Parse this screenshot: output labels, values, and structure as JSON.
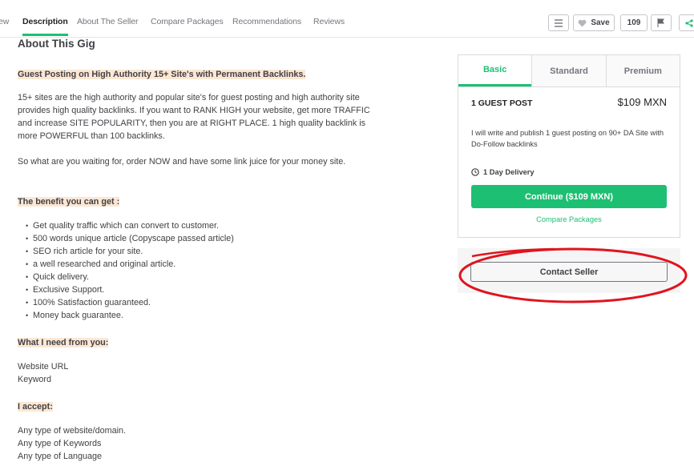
{
  "nav": {
    "tabs": [
      "ew",
      "Description",
      "About The Seller",
      "Compare Packages",
      "Recommendations",
      "Reviews"
    ],
    "save_label": "Save",
    "save_count": "109"
  },
  "main": {
    "title": "About This Gig",
    "headline": "Guest Posting on High Authority 15+ Site's with Permanent Backlinks.",
    "intro_lines": [
      "15+ sites are the high authority and popular site's for guest posting and high authority site",
      "provides high quality backlinks. If you want to RANK HIGH your website, get more TRAFFIC",
      "and increase SITE POPULARITY, then you are at RIGHT PLACE. 1 high quality backlink is",
      "more POWERFUL than 100 backlinks."
    ],
    "cta_line": "So what are you waiting for, order NOW and have some link juice for your money site.",
    "benefit_heading": "The benefit you can get :",
    "benefits": [
      "Get quality traffic which can convert to customer.",
      "500 words unique article (Copyscape passed article)",
      "SEO rich article for your site.",
      "a well researched and original article.",
      "Quick delivery.",
      "Exclusive Support.",
      "100% Satisfaction guaranteed.",
      "Money back guarantee."
    ],
    "need_heading": "What I need from you:",
    "need_items": [
      "Website URL",
      "Keyword"
    ],
    "accept_heading": "I accept:",
    "accept_items": [
      "Any type of website/domain.",
      "Any type of Keywords",
      "Any type of Language"
    ]
  },
  "package": {
    "tabs": [
      "Basic",
      "Standard",
      "Premium"
    ],
    "name": "1 GUEST POST",
    "price": "$109 MXN",
    "description": "I will write and publish 1 guest posting on 90+ DA Site with Do-Follow backlinks",
    "delivery": "1 Day Delivery",
    "continue_label": "Continue ($109 MXN)",
    "compare_label": "Compare Packages"
  },
  "contact_label": "Contact Seller",
  "colors": {
    "accent": "#1dbf73",
    "highlight": "#fbe7d4",
    "annotation": "#e0141e"
  }
}
